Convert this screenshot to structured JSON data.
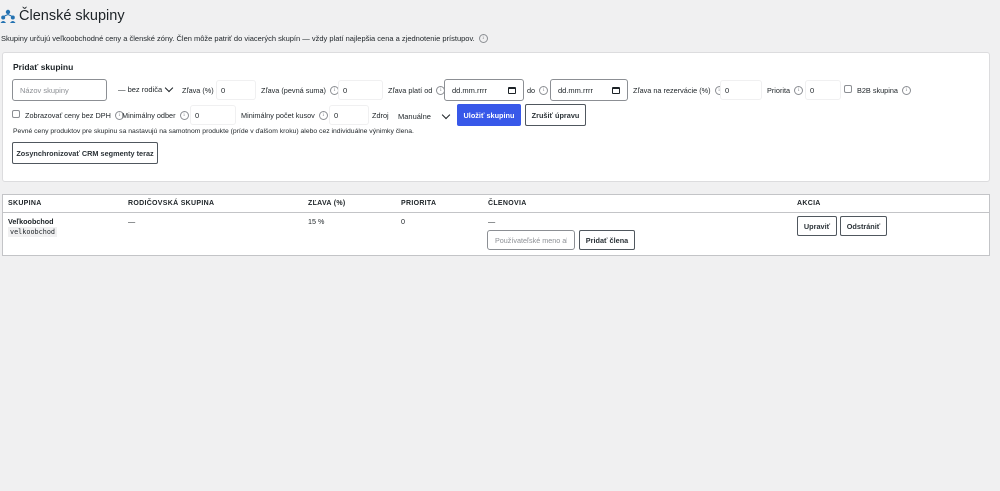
{
  "header": {
    "title": "Členské skupiny",
    "description": "Skupiny určujú veľkoobchodné ceny a členské zóny. Člen môže patriť do viacerých skupín — vždy platí najlepšia cena a zjednotenie prístupov."
  },
  "form": {
    "title": "Pridať skupinu",
    "name_placeholder": "Názov skupiny",
    "parent_label": "— bez rodiča",
    "discount_label": "Zľava (%)",
    "discount_value": "0",
    "fixed_discount_label": "Zľava (pevná suma)",
    "fixed_discount_value": "0",
    "valid_from_label": "Zľava platí od",
    "valid_from_value": "dd.mm.rrrr",
    "to_label": "do",
    "valid_to_value": "dd.mm.rrrr",
    "reservation_label": "Zľava na rezervácie (%)",
    "reservation_value": "0",
    "priority_label": "Priorita",
    "priority_value": "0",
    "b2b_label": "B2B skupina",
    "show_without_vat_label": "Zobrazovať ceny bez DPH",
    "min_order_label": "Minimálny odber",
    "min_order_value": "0",
    "min_qty_label": "Minimálny počet kusov",
    "min_qty_value": "0",
    "source_label": "Zdroj",
    "source_value": "Manuálne",
    "save_button": "Uložiť skupinu",
    "cancel_button": "Zrušiť úpravu",
    "help_text": "Pevné ceny produktov pre skupinu sa nastavujú na samotnom produkte (príde v ďalšom kroku) alebo cez individuálne výnimky člena.",
    "sync_button": "Zosynchronizovať CRM segmenty teraz"
  },
  "table": {
    "columns": [
      "SKUPINA",
      "RODIČOVSKÁ SKUPINA",
      "ZĽAVA (%)",
      "PRIORITA",
      "ČLENOVIA",
      "AKCIA"
    ],
    "rows": [
      {
        "name": "Veľkoobchod",
        "slug": "velkoobchod",
        "parent": "—",
        "discount": "15 %",
        "priority": "0",
        "members": "—",
        "member_input_placeholder": "Používateľské meno al",
        "add_member_button": "Pridať člena",
        "edit_button": "Upraviť",
        "delete_button": "Odstrániť"
      }
    ]
  },
  "colors": {
    "primary": "#3858e9",
    "background": "#f0f0f1",
    "icon": "#2271b1"
  }
}
